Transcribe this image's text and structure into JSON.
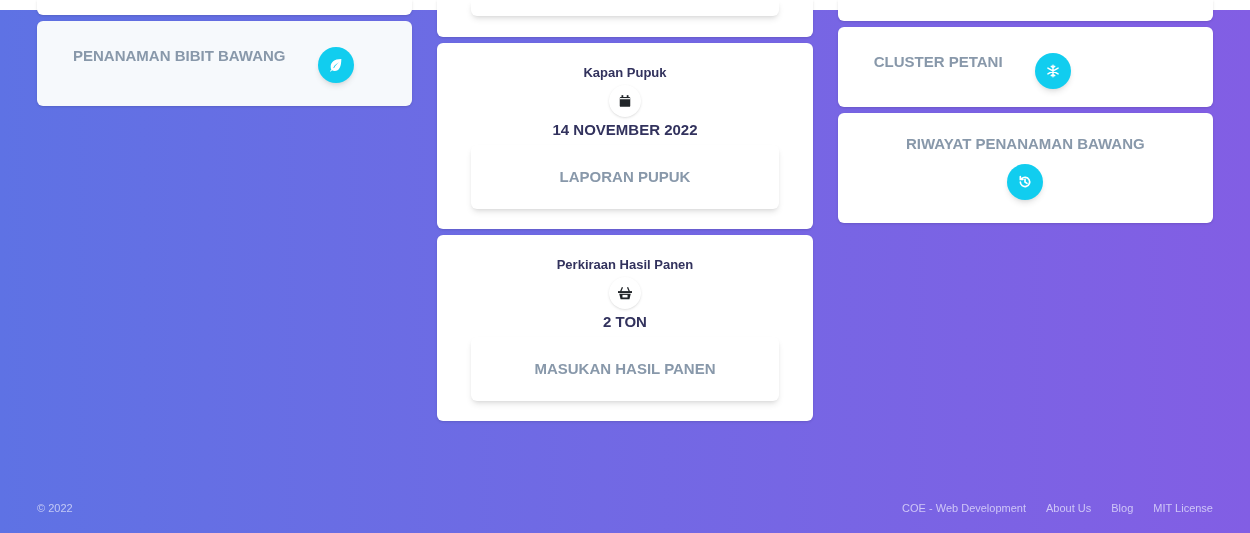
{
  "left_column": [
    {
      "kind": "stub"
    },
    {
      "kind": "inline",
      "title": "PENANAMAN BIBIT BAWANG"
    }
  ],
  "middle_column": [
    {
      "kind": "stub"
    },
    {
      "kind": "stat",
      "label": "Kapan Pupuk",
      "value": "14 NOVEMBER 2022",
      "button": "LAPORAN PUPUK"
    },
    {
      "kind": "stat",
      "label": "Perkiraan Hasil Panen",
      "value": "2 TON",
      "button": "MASUKAN HASIL PANEN"
    }
  ],
  "right_column": [
    {
      "kind": "stub"
    },
    {
      "kind": "inline",
      "title": "CLUSTER PETANI"
    },
    {
      "kind": "stacked",
      "title": "RIWAYAT PENANAMAN BAWANG"
    }
  ],
  "footer": {
    "copyright": "© 2022",
    "links": [
      "COE - Web Development",
      "About Us",
      "Blog",
      "MIT License"
    ]
  }
}
